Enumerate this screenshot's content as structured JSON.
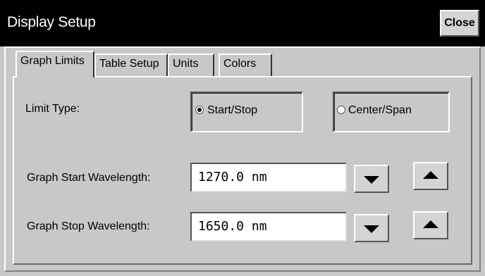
{
  "window": {
    "title": "Display Setup",
    "close_label": "Close"
  },
  "tabs": [
    {
      "label": "Graph Limits",
      "active": true
    },
    {
      "label": "Table Setup",
      "active": false
    },
    {
      "label": "Units",
      "active": false
    },
    {
      "label": "Colors",
      "active": false
    }
  ],
  "limit_type": {
    "label": "Limit Type:",
    "options": [
      {
        "label": "Start/Stop",
        "selected": true
      },
      {
        "label": "Center/Span",
        "selected": false
      }
    ]
  },
  "start": {
    "label": "Graph Start Wavelength:",
    "value": "1270.0 nm"
  },
  "stop": {
    "label": "Graph Stop Wavelength:",
    "value": "1650.0 nm"
  },
  "icons": {
    "decrement": "triangle-down-icon",
    "increment": "triangle-up-icon"
  },
  "colors": {
    "titlebar": "#000000",
    "background": "#c8c8c8",
    "field": "#ffffff"
  }
}
